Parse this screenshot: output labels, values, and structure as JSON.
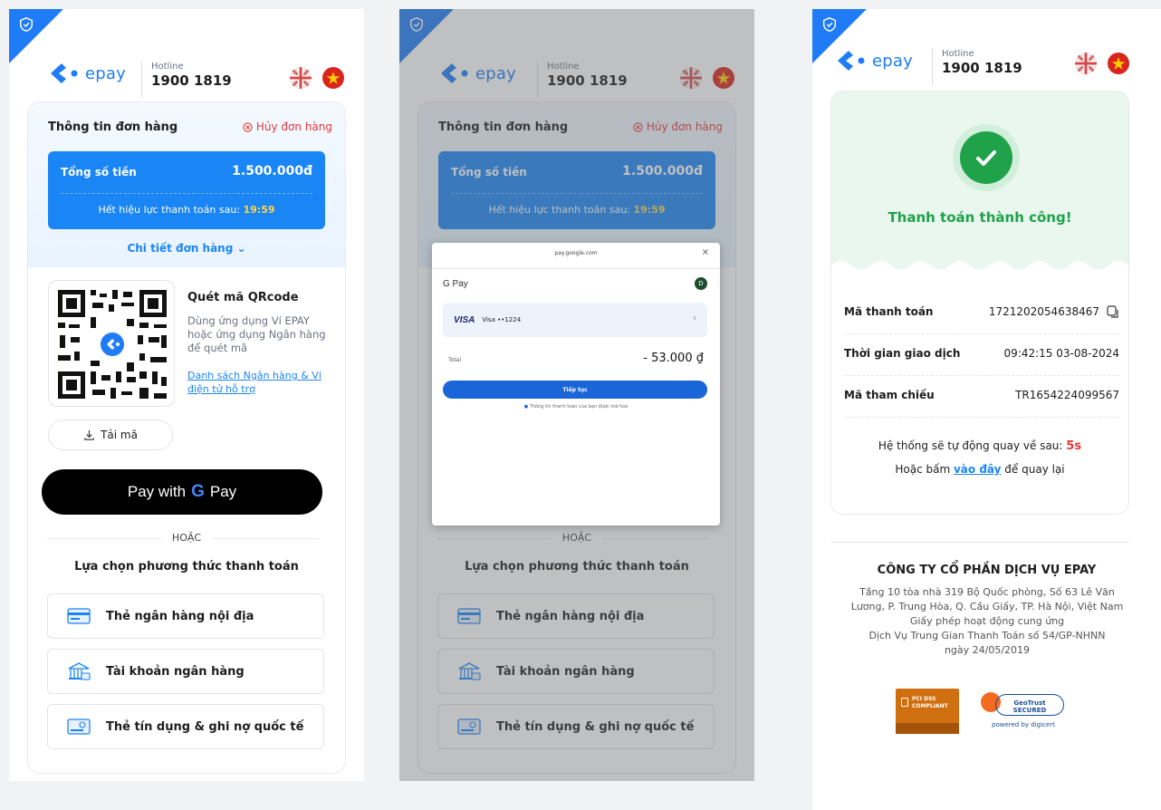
{
  "brand": {
    "name": "epay",
    "hotline_label": "Hotline",
    "hotline_number": "1900 1819"
  },
  "order": {
    "title": "Thông tin đơn hàng",
    "cancel_label": "Hủy đơn hàng",
    "total_label": "Tổng số tiền",
    "total_value": "1.500.000đ",
    "expire_label": "Hết hiệu lực thanh toán sau:",
    "expire_time": "19:59",
    "detail_label": "Chi tiết đơn hàng"
  },
  "qr": {
    "title": "Quét mã QRcode",
    "description": "Dùng ứng dụng Ví EPAY hoặc ứng dụng Ngân hàng để quét mã",
    "link": "Danh sách Ngân hàng & Ví điện tử hỗ trợ",
    "download_label": "Tải mã"
  },
  "gpay_button": {
    "prefix": "Pay with",
    "g": "G",
    "suffix": "Pay"
  },
  "or_label": "HOẶC",
  "choose_label": "Lựa chọn phương thức thanh toán",
  "methods": [
    {
      "label": "Thẻ ngân hàng nội địa",
      "icon": "debit-card-icon"
    },
    {
      "label": "Tài khoản ngân hàng",
      "icon": "bank-icon"
    },
    {
      "label": "Thẻ tín dụng & ghi nợ quốc tế",
      "icon": "credit-card-icon"
    }
  ],
  "gpay_sheet": {
    "url": "pay.google.com",
    "close": "×",
    "logo": "G Pay",
    "avatar": "D",
    "card_brand": "VISA",
    "card_label": "Visa ••1224",
    "total_label": "Total",
    "total_value": "- 53.000 ₫",
    "continue_label": "Tiếp tục",
    "note": "Thông tin thanh toán của bạn được mã hoá"
  },
  "success": {
    "message": "Thanh toán thành công!",
    "rows": [
      {
        "label": "Mã thanh toán",
        "value": "1721202054638467"
      },
      {
        "label": "Thời gian giao dịch",
        "value": "09:42:15 03-08-2024"
      },
      {
        "label": "Mã tham chiếu",
        "value": "TR1654224099567"
      }
    ],
    "auto_return_prefix": "Hệ thống sẽ tự động quay về sau:",
    "auto_return_seconds": "5s",
    "back_prefix": "Hoặc bấm",
    "back_link": "vào đây",
    "back_suffix": "để quay lại"
  },
  "footer": {
    "company": "CÔNG TY CỔ PHẦN DỊCH VỤ EPAY",
    "address_lines": [
      "Tầng 10 tòa nhà 319 Bộ Quốc phòng, Số 63 Lê Văn",
      "Lương, P. Trung Hòa, Q. Cầu Giấy, TP. Hà Nội, Việt Nam",
      "Giấy phép hoạt động cung ứng",
      "Dịch Vụ Trung Gian Thanh Toán số 54/GP-NHNN",
      "ngày 24/05/2019"
    ],
    "pci_text": "PCI DSS COMPLIANT",
    "geotrust_text": "GeoTrust SECURED",
    "geotrust_sub": "powered by digicert"
  },
  "colors": {
    "primary": "#1a85f5",
    "success": "#1fa24a",
    "danger": "#e53935",
    "highlight": "#ffd54a"
  }
}
